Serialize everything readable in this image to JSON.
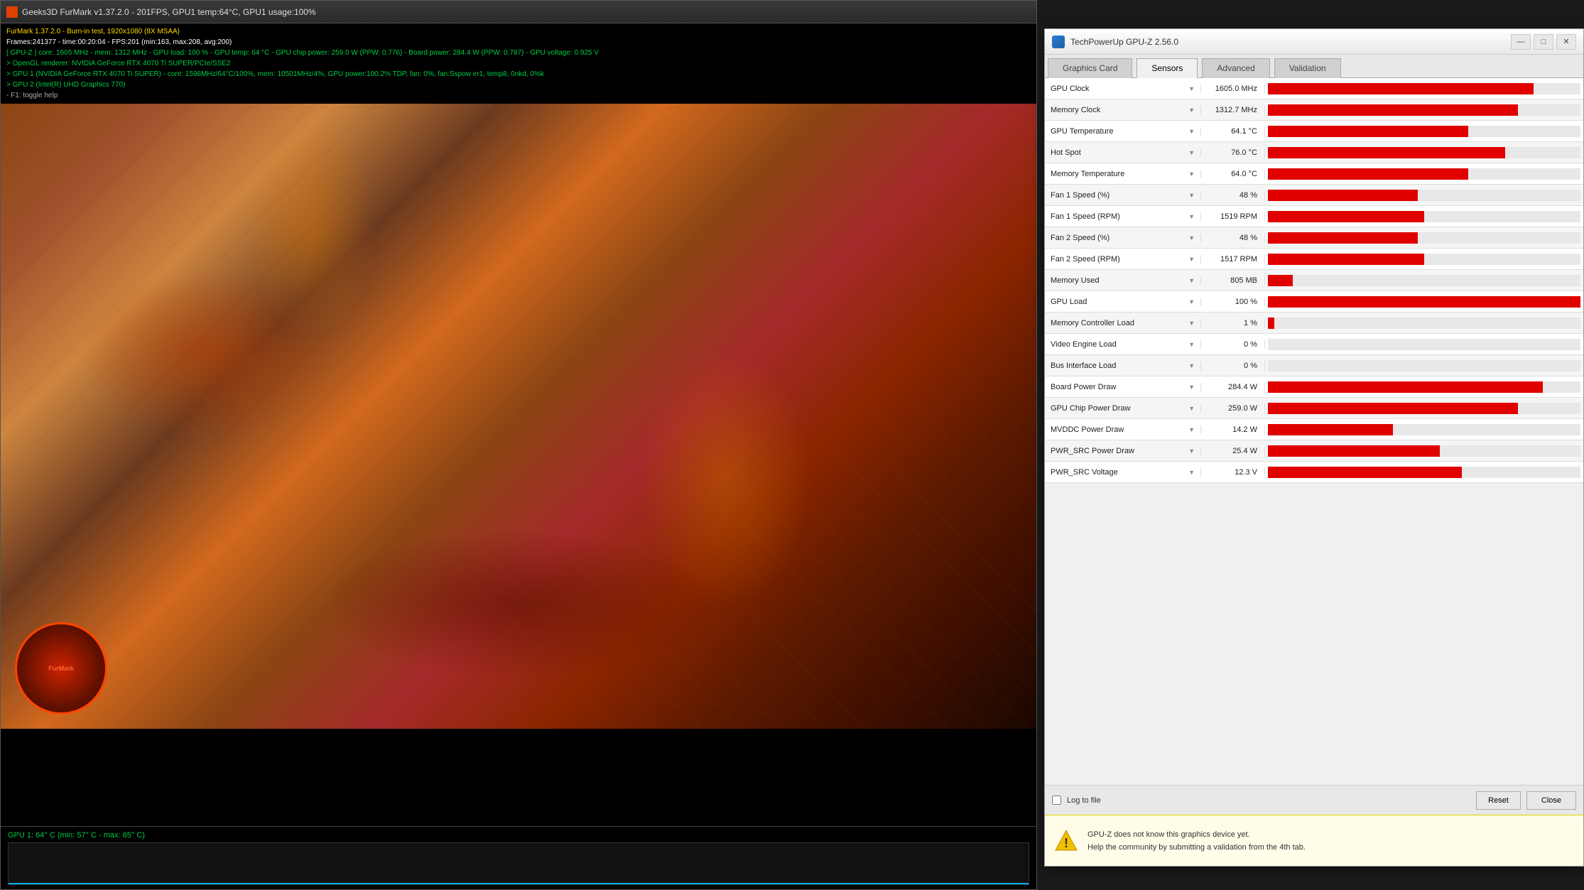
{
  "furmark": {
    "title": "Geeks3D FurMark v1.37.2.0 - 201FPS, GPU1 temp:64°C, GPU1 usage:100%",
    "info_lines": [
      {
        "text": "FurMark 1.37.2.0 - Burn-in test, 1920x1080 (8X MSAA)",
        "color": "yellow"
      },
      {
        "text": "Frames:241377 - time:00:20:04 - FPS:201 (min:163, max:208, avg:200)",
        "color": "white"
      },
      {
        "text": "[ GPU-Z ] core: 1605 MHz - mem: 1312 MHz - GPU load: 100 % - GPU temp: 64 °C - GPU chip power: 259.0 W (PPW: 0.776) - Board power: 284.4 W (PPW: 0.787) - GPU voltage: 0.925 V",
        "color": "green"
      },
      {
        "text": "> OpenGL renderer: NVIDIA GeForce RTX 4070 Ti SUPER/PCIe/SSE2",
        "color": "green"
      },
      {
        "text": "> GPU 1 (NVIDIA GeForce RTX 4070 Ti SUPER) - core: 1598MHz/64°C/100%, mem: 10501MHz/4%, GPU power:100.2%  TDP, fan: 0%, fan:Sspow er1, temp8, 0nkd, 0%k",
        "color": "green"
      },
      {
        "text": "> GPU 2 (Intel(R) UHD Graphics 770)",
        "color": "green"
      },
      {
        "text": "- F1: toggle help",
        "color": "gray"
      }
    ],
    "gpu_temp_label": "GPU 1: 64° C (min: 57° C - max: 65° C)"
  },
  "gpuz": {
    "title": "TechPowerUp GPU-Z 2.56.0",
    "tabs": [
      {
        "label": "Graphics Card",
        "active": false
      },
      {
        "label": "Sensors",
        "active": true
      },
      {
        "label": "Advanced",
        "active": false
      },
      {
        "label": "Validation",
        "active": false
      }
    ],
    "sensors": [
      {
        "label": "GPU Clock",
        "value": "1605.0 MHz",
        "bar_pct": 85
      },
      {
        "label": "Memory Clock",
        "value": "1312.7 MHz",
        "bar_pct": 80
      },
      {
        "label": "GPU Temperature",
        "value": "64.1 °C",
        "bar_pct": 64
      },
      {
        "label": "Hot Spot",
        "value": "76.0 °C",
        "bar_pct": 76
      },
      {
        "label": "Memory Temperature",
        "value": "64.0 °C",
        "bar_pct": 64
      },
      {
        "label": "Fan 1 Speed (%)",
        "value": "48 %",
        "bar_pct": 48
      },
      {
        "label": "Fan 1 Speed (RPM)",
        "value": "1519 RPM",
        "bar_pct": 50
      },
      {
        "label": "Fan 2 Speed (%)",
        "value": "48 %",
        "bar_pct": 48
      },
      {
        "label": "Fan 2 Speed (RPM)",
        "value": "1517 RPM",
        "bar_pct": 50
      },
      {
        "label": "Memory Used",
        "value": "805 MB",
        "bar_pct": 8
      },
      {
        "label": "GPU Load",
        "value": "100 %",
        "bar_pct": 100
      },
      {
        "label": "Memory Controller Load",
        "value": "1 %",
        "bar_pct": 2
      },
      {
        "label": "Video Engine Load",
        "value": "0 %",
        "bar_pct": 0
      },
      {
        "label": "Bus Interface Load",
        "value": "0 %",
        "bar_pct": 0
      },
      {
        "label": "Board Power Draw",
        "value": "284.4 W",
        "bar_pct": 88
      },
      {
        "label": "GPU Chip Power Draw",
        "value": "259.0 W",
        "bar_pct": 80
      },
      {
        "label": "MVDDC Power Draw",
        "value": "14.2 W",
        "bar_pct": 40
      },
      {
        "label": "PWR_SRC Power Draw",
        "value": "25.4 W",
        "bar_pct": 55
      },
      {
        "label": "PWR_SRC Voltage",
        "value": "12.3 V",
        "bar_pct": 62
      }
    ],
    "gpu_selector": "NVIDIA GeForce RTX 4070 Ti SUPER",
    "log_to_file": "Log to file",
    "reset_button": "Reset",
    "close_button": "Close",
    "notice_line1": "GPU-Z does not know this graphics device yet.",
    "notice_line2": "Help the community by submitting a validation from the 4th tab.",
    "window_controls": {
      "minimize": "—",
      "maximize": "□",
      "close": "✕"
    }
  }
}
